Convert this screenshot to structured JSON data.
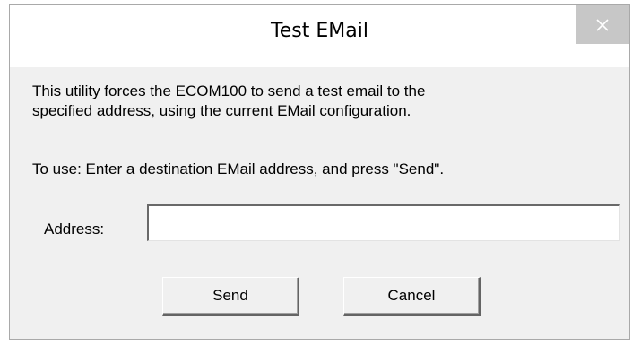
{
  "window": {
    "title": "Test EMail"
  },
  "content": {
    "description_line1": "This utility forces the ECOM100 to send a test email to the",
    "description_line2": "specified address, using the current EMail configuration.",
    "instructions": "To use: Enter a destination EMail address, and press \"Send\"."
  },
  "form": {
    "address_label": "Address:",
    "address_value": ""
  },
  "buttons": {
    "send_label": "Send",
    "cancel_label": "Cancel"
  },
  "icons": {
    "close": "close-icon"
  },
  "colors": {
    "dialog_bg": "#f0f0f0",
    "titlebar_bg": "#ffffff",
    "close_bg": "#c7c7c7"
  }
}
